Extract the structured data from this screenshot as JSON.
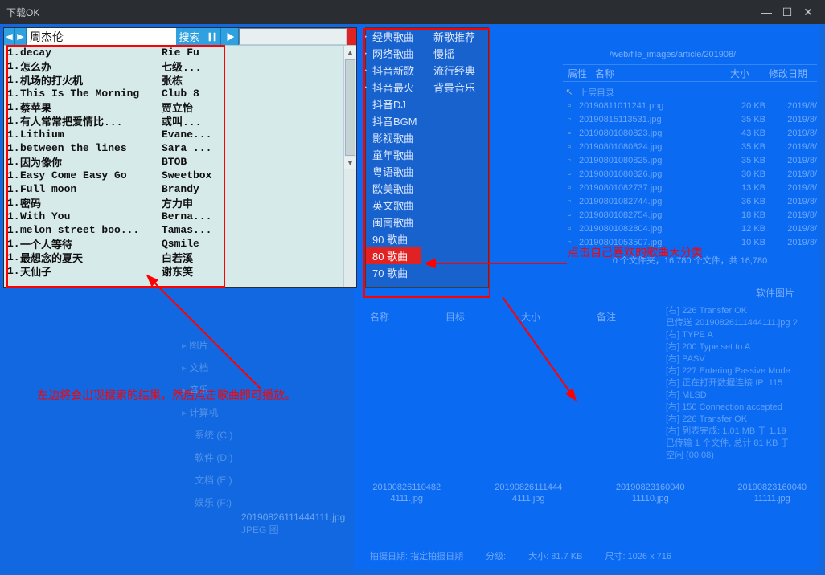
{
  "title": "下载OK",
  "toolbar": {
    "back": "◀",
    "fwd": "▶",
    "search_value": "周杰伦",
    "search_btn": "搜索"
  },
  "songs": [
    {
      "idx": "1.",
      "title": "decay",
      "artist": "Rie Fu"
    },
    {
      "idx": "1.",
      "title": "怎么办",
      "artist": "七级..."
    },
    {
      "idx": "1.",
      "title": "机场的打火机",
      "artist": "张栋"
    },
    {
      "idx": "1.",
      "title": "This Is The Morning",
      "artist": "Club 8"
    },
    {
      "idx": "1.",
      "title": "蔡苹果",
      "artist": "贾立怡"
    },
    {
      "idx": "1.",
      "title": "有人常常把爱情比...",
      "artist": "或叫..."
    },
    {
      "idx": "1.",
      "title": "Lithium",
      "artist": "Evane..."
    },
    {
      "idx": "1.",
      "title": "between the lines",
      "artist": "Sara ..."
    },
    {
      "idx": "1.",
      "title": "因为像你",
      "artist": "BTOB"
    },
    {
      "idx": "1.",
      "title": "Easy Come Easy Go",
      "artist": "Sweetbox"
    },
    {
      "idx": "1.",
      "title": "Full moon",
      "artist": "Brandy"
    },
    {
      "idx": "1.",
      "title": "密码",
      "artist": "方力申"
    },
    {
      "idx": "1.",
      "title": "With You",
      "artist": "Berna..."
    },
    {
      "idx": "1.",
      "title": "melon street boo...",
      "artist": "Tamas..."
    },
    {
      "idx": "1.",
      "title": "一个人等待",
      "artist": "Qsmile"
    },
    {
      "idx": "1.",
      "title": "最想念的夏天",
      "artist": "白若溪"
    },
    {
      "idx": "1.",
      "title": "天仙子",
      "artist": "谢东笑"
    }
  ],
  "categories": [
    {
      "l": "经典歌曲",
      "mark": true
    },
    {
      "l": "新歌推荐"
    },
    {
      "l": "网络歌曲",
      "mark": true
    },
    {
      "l": "慢摇"
    },
    {
      "l": "抖音新歌",
      "mark": true
    },
    {
      "l": "流行经典"
    },
    {
      "l": "抖音最火",
      "mark": true
    },
    {
      "l": "背景音乐"
    },
    {
      "l": "抖音DJ"
    },
    {
      "l": ""
    },
    {
      "l": "抖音BGM"
    },
    {
      "l": ""
    },
    {
      "l": "影视歌曲"
    },
    {
      "l": ""
    },
    {
      "l": "童年歌曲"
    },
    {
      "l": ""
    },
    {
      "l": "粤语歌曲"
    },
    {
      "l": ""
    },
    {
      "l": "欧美歌曲"
    },
    {
      "l": ""
    },
    {
      "l": "英文歌曲"
    },
    {
      "l": ""
    },
    {
      "l": "闽南歌曲"
    },
    {
      "l": ""
    },
    {
      "l": "90 歌曲"
    },
    {
      "l": ""
    },
    {
      "l": "80 歌曲",
      "hot": true
    },
    {
      "l": ""
    },
    {
      "l": "70 歌曲"
    },
    {
      "l": ""
    }
  ],
  "note_a": "左边将会出现搜索的结果，然后点击歌曲即可播放。",
  "note_b": "点击自己喜欢的歌曲大分类",
  "filebrowser": {
    "path": "/web/file_images/article/201908/",
    "attr": "属性",
    "headers": {
      "name": "名称",
      "size": "大小",
      "date": "修改日期"
    },
    "up": "上层目录",
    "rows": [
      {
        "n": "20190811011241.png",
        "s": "20 KB",
        "d": "2019/8/"
      },
      {
        "n": "20190815113531.jpg",
        "s": "35 KB",
        "d": "2019/8/"
      },
      {
        "n": "20190801080823.jpg",
        "s": "43 KB",
        "d": "2019/8/"
      },
      {
        "n": "20190801080824.jpg",
        "s": "35 KB",
        "d": "2019/8/"
      },
      {
        "n": "20190801080825.jpg",
        "s": "35 KB",
        "d": "2019/8/"
      },
      {
        "n": "20190801080826.jpg",
        "s": "30 KB",
        "d": "2019/8/"
      },
      {
        "n": "20190801082737.jpg",
        "s": "13 KB",
        "d": "2019/8/"
      },
      {
        "n": "20190801082744.jpg",
        "s": "36 KB",
        "d": "2019/8/"
      },
      {
        "n": "20190801082754.jpg",
        "s": "18 KB",
        "d": "2019/8/"
      },
      {
        "n": "20190801082804.jpg",
        "s": "12 KB",
        "d": "2019/8/"
      },
      {
        "n": "20190801053507.jpg",
        "s": "10 KB",
        "d": "2019/8/"
      }
    ],
    "summary": "0 个文件夹，16,780 个文件，共 16,780",
    "soft_title": "软件图片"
  },
  "log": [
    "[右] 226 Transfer OK",
    "已传送  20190826111444111.jpg ?",
    "[右] TYPE A",
    "[右] 200 Type set to A",
    "[右] PASV",
    "[右] 227 Entering Passive Mode",
    "[右] 正在打开数据连接 IP: 115",
    "[右] MLSD",
    "[右] 150 Connection accepted",
    "[右] 226 Transfer OK",
    "[右] 列表完成: 1.01 MB 于 1.19",
    "已传输 1 个文件, 总计 81 KB 于",
    "空闲 (00:08)"
  ],
  "mid_headers": {
    "name": "名称",
    "target": "目标",
    "size": "大小",
    "note": "备注"
  },
  "sidebar": {
    "items": [
      "图片",
      "文档",
      "音乐"
    ],
    "computer": "计算机",
    "drives": [
      "系统 (C:)",
      "软件 (D:)",
      "文档 (E:)",
      "娱乐 (F:)"
    ]
  },
  "thumbs": [
    "20190826110482 4111.jpg",
    "20190826111444 4111.jpg",
    "20190823160040 11110.jpg",
    "20190823160040 11111.jpg"
  ],
  "bottom": {
    "fname": "20190826111444111.jpg",
    "meta": [
      "拍摄日期: 指定拍摄日期",
      "分级:",
      "大小: 81.7 KB",
      "尺寸: 1026 x 716"
    ],
    "jpeg": "JPEG 图"
  }
}
